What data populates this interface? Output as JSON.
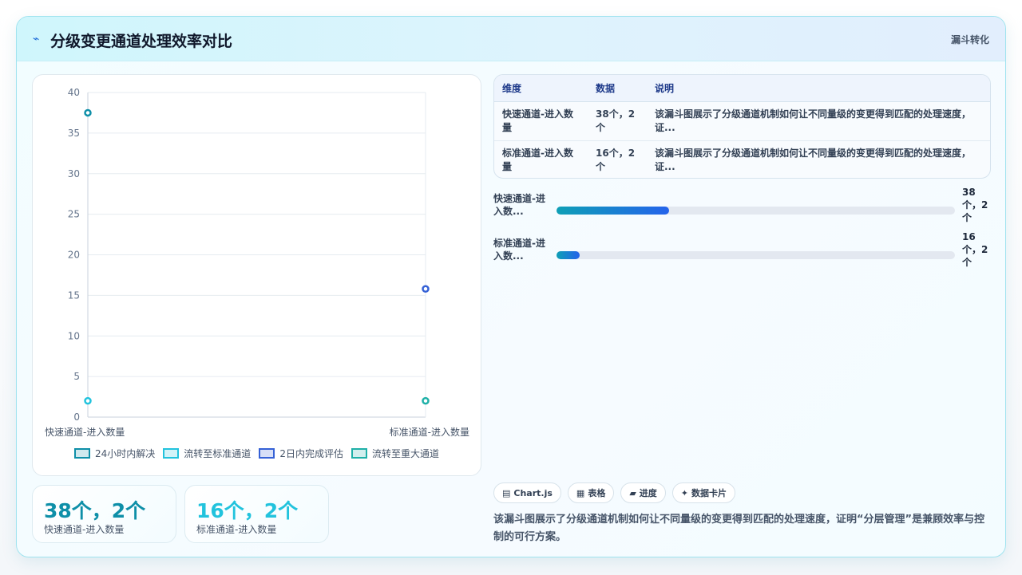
{
  "header": {
    "title": "分级变更通道处理效率对比",
    "tag": "漏斗转化",
    "icon": "bolt-icon"
  },
  "chart_data": {
    "type": "scatter",
    "categories": [
      "快速通道-进入数量",
      "标准通道-进入数量"
    ],
    "ylim": [
      0,
      40
    ],
    "yticks": [
      0,
      5,
      10,
      15,
      20,
      25,
      30,
      35,
      40
    ],
    "grid": true,
    "legend_position": "bottom",
    "series": [
      {
        "name": "24小时内解决",
        "values": [
          37.5,
          null
        ],
        "color": "#0e8fa8"
      },
      {
        "name": "流转至标准通道",
        "values": [
          2,
          null
        ],
        "color": "#22c3dd"
      },
      {
        "name": "2日内完成评估",
        "values": [
          null,
          15.8
        ],
        "color": "#3561d6"
      },
      {
        "name": "流转至重大通道",
        "values": [
          null,
          2
        ],
        "color": "#1fb0a8"
      }
    ]
  },
  "stats": [
    {
      "value": "38个，2个",
      "label": "快速通道-进入数量",
      "color": "#0e8fa8"
    },
    {
      "value": "16个，2个",
      "label": "标准通道-进入数量",
      "color": "#22c3dd"
    }
  ],
  "table": {
    "headers": [
      "维度",
      "数据",
      "说明"
    ],
    "rows": [
      [
        "快速通道-进入数量",
        "38个，2个",
        "该漏斗图展示了分级通道机制如何让不同量级的变更得到匹配的处理速度，证..."
      ],
      [
        "标准通道-进入数量",
        "16个，2个",
        "该漏斗图展示了分级通道机制如何让不同量级的变更得到匹配的处理速度，证..."
      ]
    ]
  },
  "progress": [
    {
      "label": "快速通道-进入数...",
      "value": "38个，2个",
      "fraction": 0.283
    },
    {
      "label": "标准通道-进入数...",
      "value": "16个，2个",
      "fraction": 0.059
    }
  ],
  "chips": [
    {
      "icon": "chart-icon",
      "glyph": "▤",
      "label": "Chart.js"
    },
    {
      "icon": "table-icon",
      "glyph": "▦",
      "label": "表格"
    },
    {
      "icon": "progress-icon",
      "glyph": "▰",
      "label": "进度"
    },
    {
      "icon": "sparkle-icon",
      "glyph": "✦",
      "label": "数据卡片"
    }
  ],
  "footer": "该漏斗图展示了分级通道机制如何让不同量级的变更得到匹配的处理速度，证明“分层管理”是兼顾效率与控制的可行方案。"
}
